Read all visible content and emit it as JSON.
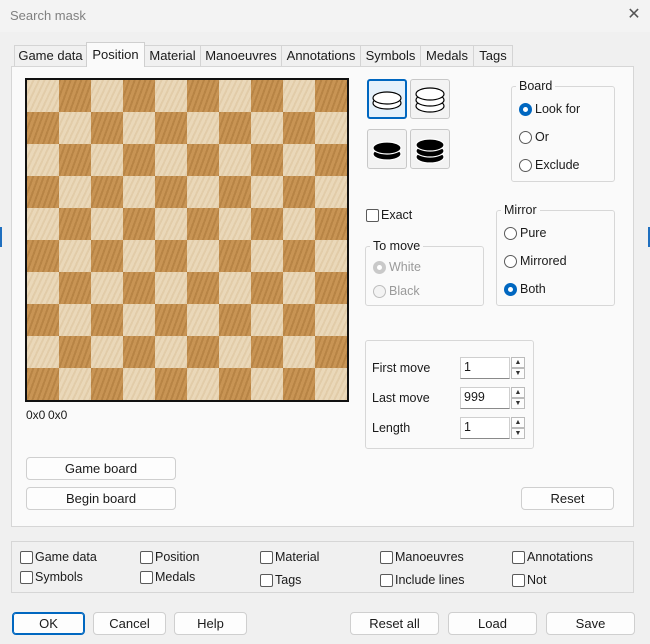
{
  "window": {
    "title": "Search mask",
    "close_glyph": "✕"
  },
  "tabs": [
    {
      "label": "Game data"
    },
    {
      "label": "Position",
      "active": true
    },
    {
      "label": "Material"
    },
    {
      "label": "Manoeuvres"
    },
    {
      "label": "Annotations"
    },
    {
      "label": "Symbols"
    },
    {
      "label": "Medals"
    },
    {
      "label": "Tags"
    }
  ],
  "board": {
    "size": 10,
    "coords_left": "0x0",
    "coords_right": "0x0",
    "light_color": "#ead8b9",
    "dark_color": "#c89454"
  },
  "piece_buttons": [
    {
      "icon": "white-man-icon",
      "selected": true
    },
    {
      "icon": "white-king-icon",
      "selected": false
    },
    {
      "icon": "black-man-icon",
      "selected": false
    },
    {
      "icon": "black-king-icon",
      "selected": false
    }
  ],
  "board_group": {
    "legend": "Board",
    "options": [
      "Look for",
      "Or",
      "Exclude"
    ],
    "selected": "Look for"
  },
  "exact": {
    "label": "Exact",
    "checked": false
  },
  "to_move": {
    "legend": "To move",
    "options": [
      "White",
      "Black"
    ],
    "selected": "White",
    "disabled": true
  },
  "mirror": {
    "legend": "Mirror",
    "options": [
      "Pure",
      "Mirrored",
      "Both"
    ],
    "selected": "Both"
  },
  "moves": {
    "first": {
      "label": "First move",
      "value": "1"
    },
    "last": {
      "label": "Last move",
      "value": "999"
    },
    "length": {
      "label": "Length",
      "value": "1"
    }
  },
  "buttons": {
    "game_board": "Game board",
    "begin_board": "Begin board",
    "reset": "Reset"
  },
  "filters": [
    {
      "label": "Game data",
      "checked": false
    },
    {
      "label": "Position",
      "checked": false
    },
    {
      "label": "Material",
      "checked": false
    },
    {
      "label": "Manoeuvres",
      "checked": false
    },
    {
      "label": "Annotations",
      "checked": false
    },
    {
      "label": "Symbols",
      "checked": false
    },
    {
      "label": "Medals",
      "checked": false
    },
    {
      "label": "Tags",
      "checked": false
    },
    {
      "label": "Include lines",
      "checked": false
    },
    {
      "label": "Not",
      "checked": false
    }
  ],
  "footer": {
    "ok": "OK",
    "cancel": "Cancel",
    "help": "Help",
    "reset_all": "Reset all",
    "load": "Load",
    "save": "Save"
  },
  "colors": {
    "accent": "#0067c0"
  }
}
